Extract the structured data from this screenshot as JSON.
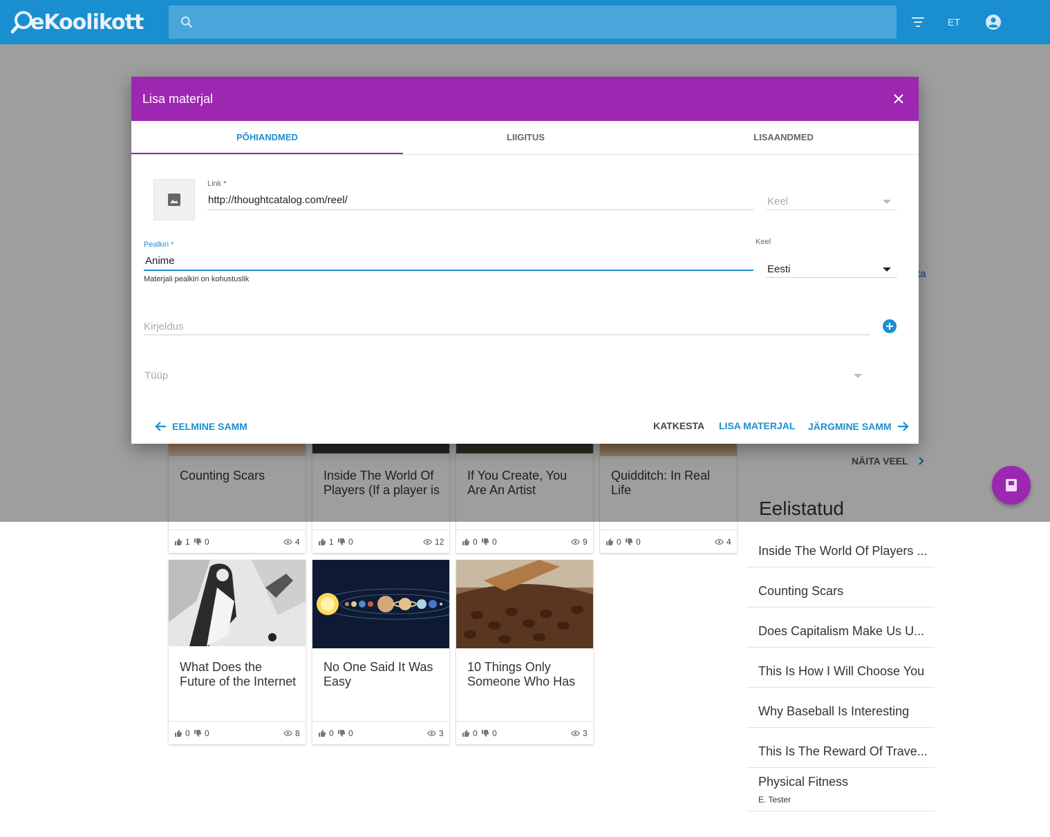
{
  "header": {
    "logo_text": "eKoolikott",
    "language": "ET"
  },
  "dialog": {
    "title": "Lisa materjal",
    "tabs": [
      {
        "label": "PÕHIANDMED"
      },
      {
        "label": "LIIGITUS"
      },
      {
        "label": "LISAANDMED"
      }
    ],
    "link_label": "Link *",
    "link_value": "http://thoughtcatalog.com/reel/",
    "link_language_placeholder": "Keel",
    "title_label": "Pealkiri *",
    "title_value": "Anime",
    "title_hint": "Materjali pealkiri on kohustuslik",
    "language_label": "Keel",
    "language_value": "Eesti",
    "description_placeholder": "Kirjeldus",
    "type_placeholder": "Tüüp",
    "prev_button": "EELMINE SAMM",
    "cancel_button": "KATKESTA",
    "add_button": "LISA MATERJAL",
    "next_button": "JÄRGMINE SAMM"
  },
  "materials_row1": [
    {
      "title": "Counting Scars",
      "likes": "1",
      "dislikes": "0",
      "views": "4"
    },
    {
      "title": "Inside The World Of Players (If a player is",
      "likes": "1",
      "dislikes": "0",
      "views": "12"
    },
    {
      "title": "If You Create, You Are An Artist",
      "likes": "0",
      "dislikes": "0",
      "views": "9"
    },
    {
      "title": "Quidditch: In Real Life",
      "likes": "0",
      "dislikes": "0",
      "views": "4"
    }
  ],
  "materials_row2": [
    {
      "title": "What Does the Future of the Internet",
      "likes": "0",
      "dislikes": "0",
      "views": "8"
    },
    {
      "title": "No One Said It Was Easy",
      "likes": "0",
      "dislikes": "0",
      "views": "3"
    },
    {
      "title": "10 Things Only Someone Who Has",
      "likes": "0",
      "dislikes": "0",
      "views": "3"
    }
  ],
  "show_more": "NÄITA VEEL",
  "partial_link_text": "ta",
  "featured": {
    "title": "Eelistatud",
    "items": [
      {
        "title": "Inside The World Of Players ..."
      },
      {
        "title": "Counting Scars"
      },
      {
        "title": "Does Capitalism Make Us U..."
      },
      {
        "title": "This Is How I Will Choose You"
      },
      {
        "title": "Why Baseball Is Interesting"
      },
      {
        "title": "This Is The Reward Of Trave..."
      },
      {
        "title": "Physical Fitness",
        "author": "E. Tester"
      }
    ]
  },
  "colors": {
    "header_blue": "#1a8fd0",
    "dialog_purple": "#9c27b0",
    "accent_blue": "#1a8fd0"
  }
}
